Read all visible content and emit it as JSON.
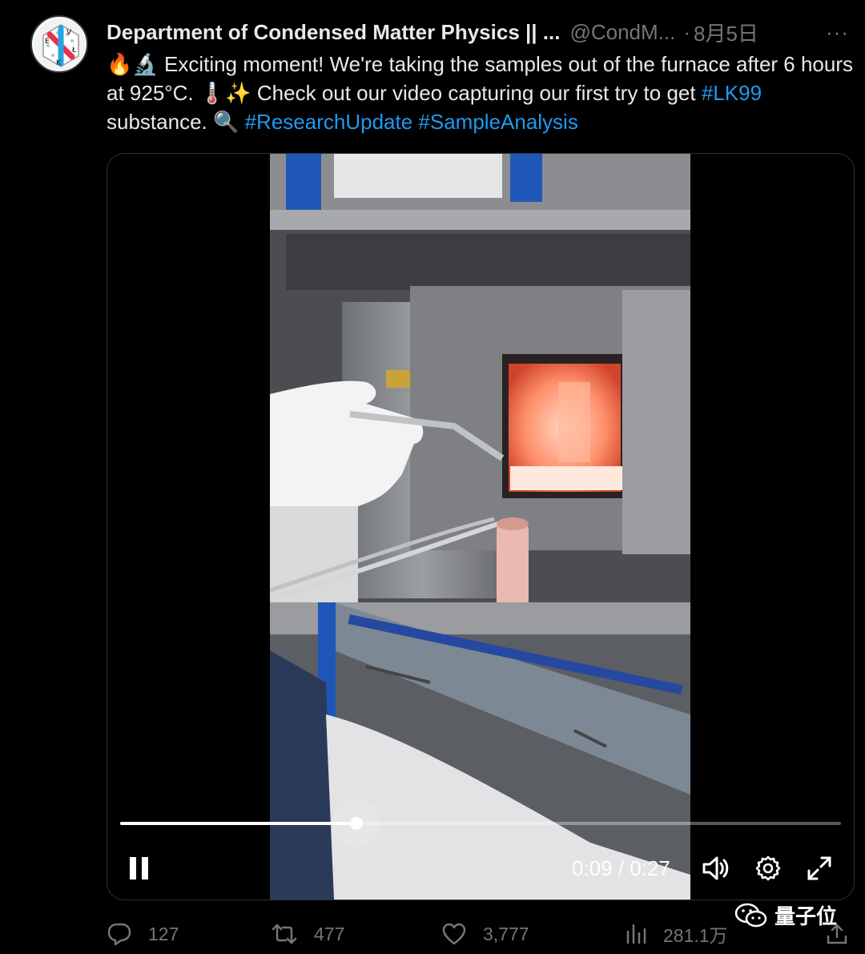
{
  "tweet": {
    "author_name": "Department of Condensed Matter Physics || ...",
    "handle": "@CondM...",
    "separator": "·",
    "date": "8月5日",
    "more": "···",
    "text": {
      "emoji_1": "🔥🔬",
      "part_1": " Exciting moment! We're taking the samples out of the furnace after 6 hours at  925°C. ",
      "emoji_2": "🌡️✨",
      "part_2": " Check out our video capturing our first try to get ",
      "hashtag_1": "#LK99",
      "part_3": " substance. ",
      "emoji_3": "🔍",
      "hashtag_2": "#ResearchUpdate",
      "hashtag_3": "#SampleAnalysis"
    },
    "avatar_letters": [
      "E",
      "V",
      "K",
      "Ł"
    ]
  },
  "video": {
    "current_time": "0:09",
    "time_separator": " / ",
    "duration": "0:27",
    "progress_fraction": 0.3273,
    "state": "playing",
    "icons": [
      "pause-icon",
      "volume-icon",
      "settings-gear-icon",
      "fullscreen-icon"
    ]
  },
  "actions": {
    "replies": "127",
    "retweets": "477",
    "likes": "3,777",
    "views": "281.1万"
  },
  "watermark": {
    "text": "量子位"
  },
  "colors": {
    "background": "#000000",
    "text": "#e7e9ea",
    "muted": "#71767b",
    "hashtag": "#1d9bf0",
    "border": "#2f3336"
  }
}
